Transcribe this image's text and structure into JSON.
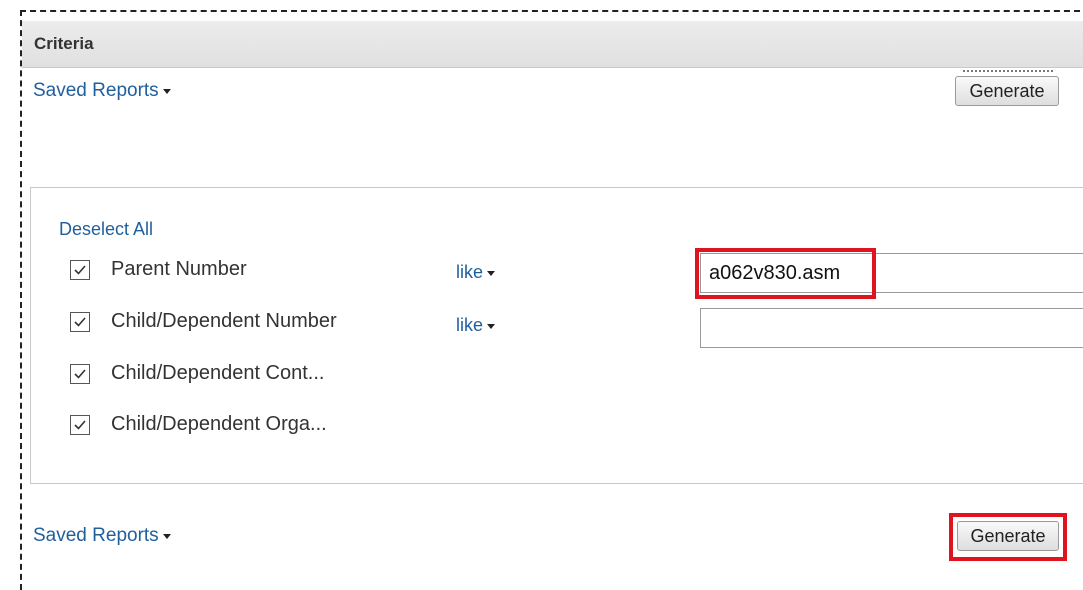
{
  "criteria": {
    "title": "Criteria"
  },
  "toolbar": {
    "saved_reports_label": "Saved Reports",
    "generate_label": "Generate"
  },
  "panel": {
    "deselect_all_label": "Deselect All",
    "rows": [
      {
        "label": "Parent Number",
        "checked": true,
        "operator": "like",
        "value": "a062v830.asm"
      },
      {
        "label": "Child/Dependent Number",
        "checked": true,
        "operator": "like",
        "value": ""
      },
      {
        "label": "Child/Dependent Cont...",
        "checked": true
      },
      {
        "label": "Child/Dependent Orga...",
        "checked": true
      }
    ]
  },
  "colors": {
    "link": "#1f5f9e",
    "highlight_border": "#e0141e",
    "header_bg": "#e6e6e6"
  }
}
